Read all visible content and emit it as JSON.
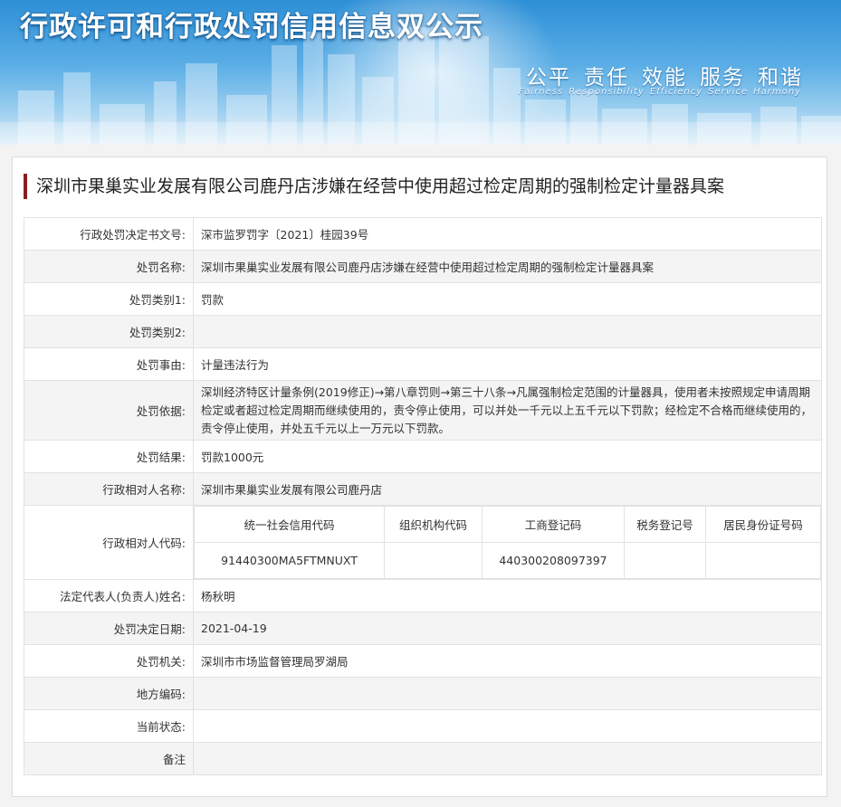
{
  "banner": {
    "title": "行政许可和行政处罚信用信息双公示",
    "slogan_zh": [
      "公平",
      "责任",
      "效能",
      "服务",
      "和谐"
    ],
    "slogan_en": [
      "Fairness",
      "Responsibility",
      "Efficiency",
      "Service",
      "Harmony"
    ]
  },
  "case_title": "深圳市果巢实业发展有限公司鹿丹店涉嫌在经营中使用超过检定周期的强制检定计量器具案",
  "rows": {
    "decision_no": {
      "label": "行政处罚决定书文号:",
      "value": "深市监罗罚字〔2021〕桂园39号"
    },
    "penalty_name": {
      "label": "处罚名称:",
      "value": "深圳市果巢实业发展有限公司鹿丹店涉嫌在经营中使用超过检定周期的强制检定计量器具案"
    },
    "category1": {
      "label": "处罚类别1:",
      "value": "罚款"
    },
    "category2": {
      "label": "处罚类别2:",
      "value": ""
    },
    "cause": {
      "label": "处罚事由:",
      "value": "计量违法行为"
    },
    "basis": {
      "label": "处罚依据:",
      "value": "深圳经济特区计量条例(2019修正)→第八章罚则→第三十八条→凡属强制检定范围的计量器具，使用者未按照规定申请周期检定或者超过检定周期而继续使用的，责令停止使用，可以并处一千元以上五千元以下罚款；经检定不合格而继续使用的，责令停止使用，并处五千元以上一万元以下罚款。"
    },
    "result": {
      "label": "处罚结果:",
      "value": "罚款1000元"
    },
    "party_name": {
      "label": "行政相对人名称:",
      "value": "深圳市果巢实业发展有限公司鹿丹店"
    },
    "party_code": {
      "label": "行政相对人代码:",
      "headers": [
        "统一社会信用代码",
        "组织机构代码",
        "工商登记码",
        "税务登记号",
        "居民身份证号码"
      ],
      "values": [
        "91440300MA5FTMNUXT",
        "",
        "440300208097397",
        "",
        ""
      ]
    },
    "legal_rep": {
      "label": "法定代表人(负责人)姓名:",
      "value": "杨秋明"
    },
    "decision_date": {
      "label": "处罚决定日期:",
      "value": "2021-04-19"
    },
    "authority": {
      "label": "处罚机关:",
      "value": "深圳市市场监督管理局罗湖局"
    },
    "local_code": {
      "label": "地方编码:",
      "value": ""
    },
    "status": {
      "label": "当前状态:",
      "value": ""
    },
    "remark": {
      "label": "备注",
      "value": ""
    }
  }
}
